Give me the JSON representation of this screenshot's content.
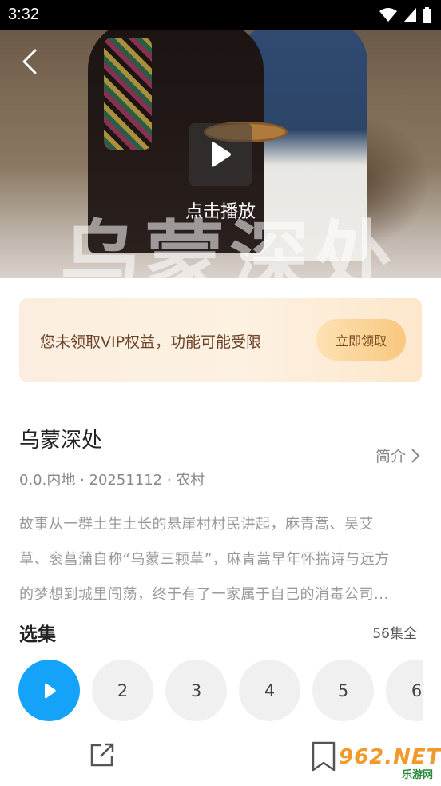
{
  "status_bar": {
    "time": "3:32"
  },
  "hero": {
    "title_art": "乌蒙深处",
    "play_label": "点击播放"
  },
  "vip_banner": {
    "text": "您未领取VIP权益，功能可能受限",
    "button": "立即领取"
  },
  "show": {
    "title": "乌蒙深处",
    "intro_link": "简介",
    "meta": "0.0.内地 · 20251112 · 农村",
    "description_lines": [
      "故事从一群土生土长的悬崖村村民讲起，麻青蒿、吴艾",
      "草、衮菖蒲自称“乌蒙三颗草”，麻青蒿早年怀揣诗与远方",
      "的梦想到城里闯荡，终于有了一家属于自己的消毒公司..."
    ]
  },
  "episodes": {
    "title": "选集",
    "count": "56集全",
    "items": [
      "2",
      "3",
      "4",
      "5",
      "6"
    ]
  },
  "watermark": {
    "brand": "962.NET",
    "sub": "乐游网"
  },
  "colors": {
    "accent": "#14a3f9",
    "vip_text": "#6b4226",
    "vip_button": "#f8c87e"
  }
}
